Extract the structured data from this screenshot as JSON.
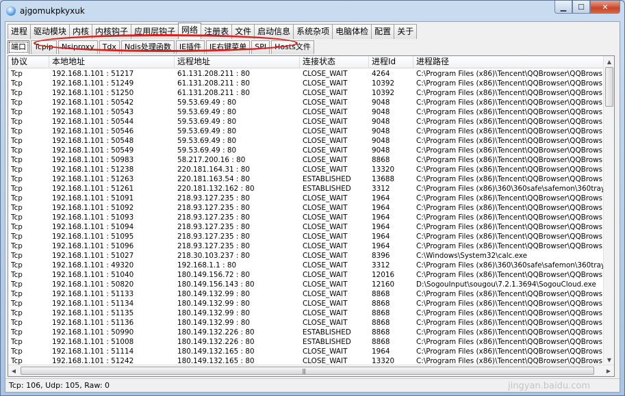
{
  "window": {
    "title": "ajgomukpkyxuk"
  },
  "main_tabs": [
    {
      "label": "进程"
    },
    {
      "label": "驱动模块"
    },
    {
      "label": "内核"
    },
    {
      "label": "内核钩子"
    },
    {
      "label": "应用层钩子"
    },
    {
      "label": "网络"
    },
    {
      "label": "注册表"
    },
    {
      "label": "文件"
    },
    {
      "label": "启动信息"
    },
    {
      "label": "系统杂项"
    },
    {
      "label": "电脑体检"
    },
    {
      "label": "配置"
    },
    {
      "label": "关于"
    }
  ],
  "active_main_tab": "网络",
  "sub_tabs": [
    {
      "label": "端口"
    },
    {
      "label": "Tcpip"
    },
    {
      "label": "Nsiproxy"
    },
    {
      "label": "Tdx"
    },
    {
      "label": "Ndis处理函数"
    },
    {
      "label": "IE插件"
    },
    {
      "label": "IE右键菜单"
    },
    {
      "label": "SPI"
    },
    {
      "label": "Hosts文件"
    }
  ],
  "active_sub_tab": "端口",
  "table": {
    "columns": [
      "协议",
      "本地地址",
      "远程地址",
      "连接状态",
      "进程Id",
      "进程路径"
    ],
    "rows": [
      [
        "Tcp",
        "192.168.1.101 : 51217",
        "61.131.208.211 : 80",
        "CLOSE_WAIT",
        "4264",
        "C:\\Program Files (x86)\\Tencent\\QQBrowser\\QQBrows..."
      ],
      [
        "Tcp",
        "192.168.1.101 : 51249",
        "61.131.208.211 : 80",
        "CLOSE_WAIT",
        "10392",
        "C:\\Program Files (x86)\\Tencent\\QQBrowser\\QQBrows..."
      ],
      [
        "Tcp",
        "192.168.1.101 : 51250",
        "61.131.208.211 : 80",
        "CLOSE_WAIT",
        "10392",
        "C:\\Program Files (x86)\\Tencent\\QQBrowser\\QQBrows..."
      ],
      [
        "Tcp",
        "192.168.1.101 : 50542",
        "59.53.69.49 : 80",
        "CLOSE_WAIT",
        "9048",
        "C:\\Program Files (x86)\\Tencent\\QQBrowser\\QQBrows..."
      ],
      [
        "Tcp",
        "192.168.1.101 : 50543",
        "59.53.69.49 : 80",
        "CLOSE_WAIT",
        "9048",
        "C:\\Program Files (x86)\\Tencent\\QQBrowser\\QQBrows..."
      ],
      [
        "Tcp",
        "192.168.1.101 : 50544",
        "59.53.69.49 : 80",
        "CLOSE_WAIT",
        "9048",
        "C:\\Program Files (x86)\\Tencent\\QQBrowser\\QQBrows..."
      ],
      [
        "Tcp",
        "192.168.1.101 : 50546",
        "59.53.69.49 : 80",
        "CLOSE_WAIT",
        "9048",
        "C:\\Program Files (x86)\\Tencent\\QQBrowser\\QQBrows..."
      ],
      [
        "Tcp",
        "192.168.1.101 : 50548",
        "59.53.69.49 : 80",
        "CLOSE_WAIT",
        "9048",
        "C:\\Program Files (x86)\\Tencent\\QQBrowser\\QQBrows..."
      ],
      [
        "Tcp",
        "192.168.1.101 : 50549",
        "59.53.69.49 : 80",
        "CLOSE_WAIT",
        "9048",
        "C:\\Program Files (x86)\\Tencent\\QQBrowser\\QQBrows..."
      ],
      [
        "Tcp",
        "192.168.1.101 : 50983",
        "58.217.200.16 : 80",
        "CLOSE_WAIT",
        "8868",
        "C:\\Program Files (x86)\\Tencent\\QQBrowser\\QQBrows..."
      ],
      [
        "Tcp",
        "192.168.1.101 : 51238",
        "220.181.164.31 : 80",
        "CLOSE_WAIT",
        "13320",
        "C:\\Program Files (x86)\\Tencent\\QQBrowser\\QQBrows..."
      ],
      [
        "Tcp",
        "192.168.1.101 : 51263",
        "220.181.163.54 : 80",
        "ESTABLISHED",
        "13688",
        "C:\\Program Files (x86)\\Tencent\\QQBrowser\\QQBrows..."
      ],
      [
        "Tcp",
        "192.168.1.101 : 51261",
        "220.181.132.162 : 80",
        "ESTABLISHED",
        "3312",
        "C:\\Program Files (x86)\\360\\360safe\\safemon\\360tray..."
      ],
      [
        "Tcp",
        "192.168.1.101 : 51091",
        "218.93.127.235 : 80",
        "CLOSE_WAIT",
        "1964",
        "C:\\Program Files (x86)\\Tencent\\QQBrowser\\QQBrows..."
      ],
      [
        "Tcp",
        "192.168.1.101 : 51092",
        "218.93.127.235 : 80",
        "CLOSE_WAIT",
        "1964",
        "C:\\Program Files (x86)\\Tencent\\QQBrowser\\QQBrows..."
      ],
      [
        "Tcp",
        "192.168.1.101 : 51093",
        "218.93.127.235 : 80",
        "CLOSE_WAIT",
        "1964",
        "C:\\Program Files (x86)\\Tencent\\QQBrowser\\QQBrows..."
      ],
      [
        "Tcp",
        "192.168.1.101 : 51094",
        "218.93.127.235 : 80",
        "CLOSE_WAIT",
        "1964",
        "C:\\Program Files (x86)\\Tencent\\QQBrowser\\QQBrows..."
      ],
      [
        "Tcp",
        "192.168.1.101 : 51095",
        "218.93.127.235 : 80",
        "CLOSE_WAIT",
        "1964",
        "C:\\Program Files (x86)\\Tencent\\QQBrowser\\QQBrows..."
      ],
      [
        "Tcp",
        "192.168.1.101 : 51096",
        "218.93.127.235 : 80",
        "CLOSE_WAIT",
        "1964",
        "C:\\Program Files (x86)\\Tencent\\QQBrowser\\QQBrows..."
      ],
      [
        "Tcp",
        "192.168.1.101 : 51027",
        "218.30.103.237 : 80",
        "CLOSE_WAIT",
        "8396",
        "C:\\Windows\\System32\\calc.exe"
      ],
      [
        "Tcp",
        "192.168.1.101 : 49320",
        "192.168.1.1 : 80",
        "CLOSE_WAIT",
        "3312",
        "C:\\Program Files (x86)\\360\\360safe\\safemon\\360tray..."
      ],
      [
        "Tcp",
        "192.168.1.101 : 51040",
        "180.149.156.72 : 80",
        "CLOSE_WAIT",
        "12016",
        "C:\\Program Files (x86)\\Tencent\\QQBrowser\\QQBrows..."
      ],
      [
        "Tcp",
        "192.168.1.101 : 50820",
        "180.149.156.143 : 80",
        "CLOSE_WAIT",
        "12160",
        "D:\\SogouInput\\sougou\\7.2.1.3694\\SogouCloud.exe"
      ],
      [
        "Tcp",
        "192.168.1.101 : 51133",
        "180.149.132.99 : 80",
        "CLOSE_WAIT",
        "8868",
        "C:\\Program Files (x86)\\Tencent\\QQBrowser\\QQBrows..."
      ],
      [
        "Tcp",
        "192.168.1.101 : 51134",
        "180.149.132.99 : 80",
        "CLOSE_WAIT",
        "8868",
        "C:\\Program Files (x86)\\Tencent\\QQBrowser\\QQBrows..."
      ],
      [
        "Tcp",
        "192.168.1.101 : 51135",
        "180.149.132.99 : 80",
        "CLOSE_WAIT",
        "8868",
        "C:\\Program Files (x86)\\Tencent\\QQBrowser\\QQBrows..."
      ],
      [
        "Tcp",
        "192.168.1.101 : 51136",
        "180.149.132.99 : 80",
        "CLOSE_WAIT",
        "8868",
        "C:\\Program Files (x86)\\Tencent\\QQBrowser\\QQBrows..."
      ],
      [
        "Tcp",
        "192.168.1.101 : 50990",
        "180.149.132.226 : 80",
        "ESTABLISHED",
        "8868",
        "C:\\Program Files (x86)\\Tencent\\QQBrowser\\QQBrows..."
      ],
      [
        "Tcp",
        "192.168.1.101 : 51008",
        "180.149.132.226 : 80",
        "ESTABLISHED",
        "8868",
        "C:\\Program Files (x86)\\Tencent\\QQBrowser\\QQBrows..."
      ],
      [
        "Tcp",
        "192.168.1.101 : 51114",
        "180.149.132.165 : 80",
        "CLOSE_WAIT",
        "1964",
        "C:\\Program Files (x86)\\Tencent\\QQBrowser\\QQBrows..."
      ],
      [
        "Tcp",
        "192.168.1.101 : 51242",
        "180.149.132.165 : 80",
        "CLOSE_WAIT",
        "13320",
        "C:\\Program Files (x86)\\Tencent\\QQBrowser\\QQBrows..."
      ]
    ]
  },
  "statusbar": {
    "text": "Tcp: 106, Udp: 105, Raw: 0"
  },
  "watermark": {
    "text": "jingyan.baidu.com"
  },
  "icons": {
    "app": "app-icon",
    "minimize": "minimize-icon",
    "maximize": "maximize-icon",
    "close": "close-icon",
    "scroll_up": "scroll-up-icon",
    "scroll_down": "scroll-down-icon",
    "scroll_left": "scroll-left-icon",
    "scroll_right": "scroll-right-icon"
  },
  "colors": {
    "annotation_ellipse": "#d8201c",
    "window_frame": "#a9c4e2",
    "close_button": "#c8462c"
  }
}
